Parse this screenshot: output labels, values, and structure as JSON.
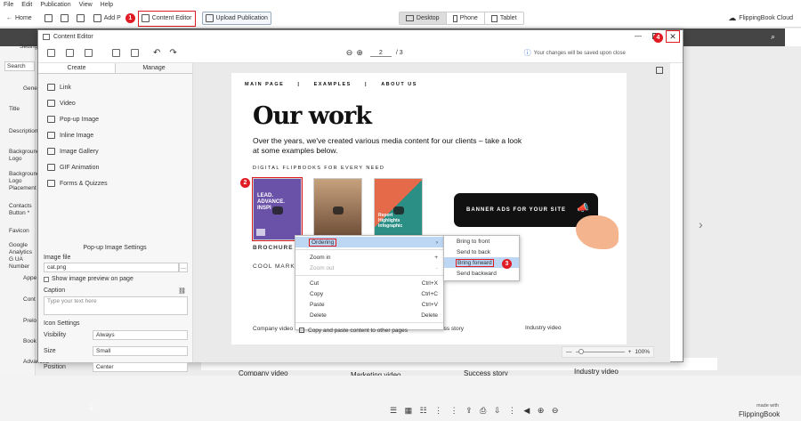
{
  "menubar": [
    "File",
    "Edit",
    "Publication",
    "View",
    "Help"
  ],
  "toolbar": {
    "home": "Home",
    "add": "Add P",
    "content_editor": "Content Editor",
    "upload": "Upload Publication",
    "devices": [
      "Desktop",
      "Phone",
      "Tablet"
    ],
    "cloud": "FlippingBook Cloud"
  },
  "badges": [
    "1",
    "2",
    "3",
    "4"
  ],
  "bg_left": {
    "settings": "Setting",
    "search": "Search",
    "items": [
      "Gene",
      "Title",
      "Description",
      "Background Logo",
      "Background Logo Placement",
      "Contacts Button *",
      "Favicon",
      "Google Analytics G UA Number",
      "Appe",
      "Cont",
      "Prelo",
      "Book",
      "Advanced"
    ]
  },
  "bg_captions": [
    "Company video",
    "Marketing video",
    "Success story",
    "Industry video"
  ],
  "bg_footer": {
    "page": "2",
    "made_with": "made with",
    "brand": "FlippingBook"
  },
  "dialog": {
    "title": "Content Editor",
    "page_current": "2",
    "page_total": "/ 3",
    "save_note": "Your changes will be saved upon close",
    "tabs": [
      "Create",
      "Manage"
    ],
    "widgets": [
      "Link",
      "Video",
      "Pop-up Image",
      "Inline Image",
      "Image Gallery",
      "GIF Animation",
      "Forms & Quizzes"
    ],
    "settings_title": "Pop-up Image Settings",
    "image_file_label": "Image file",
    "image_file_value": "cat.png",
    "show_preview": "Show image preview on page",
    "caption_label": "Caption",
    "caption_placeholder": "Type your text here",
    "icon_settings": "Icon Settings",
    "visibility_label": "Visibility",
    "visibility_value": "Always",
    "size_label": "Size",
    "size_value": "Small",
    "position_label": "Position",
    "position_value": "Center",
    "zoom": "100%"
  },
  "page": {
    "nav": [
      "MAIN PAGE",
      "|",
      "EXAMPLES",
      "|",
      "ABOUT US"
    ],
    "heading": "Our work",
    "subtitle": "Over the years, we've created various media content for our clients – take a look at some examples below.",
    "section": "DIGITAL FLIPBOOKS FOR EVERY NEED",
    "thumb1": "LEAD. ADVANCE. INSPI",
    "thumb3": "Report Highlights Infographic",
    "brochure": "BROCHURE",
    "cool": "COOL MARKI",
    "banner": "BANNER ADS FOR YOUR SITE",
    "captions": [
      "Company video",
      "ess story",
      "Industry video"
    ]
  },
  "context_menu": [
    {
      "label": "Ordering",
      "shortcut": ""
    },
    {
      "label": "Zoom in",
      "shortcut": "+"
    },
    {
      "label": "Zoom out",
      "shortcut": "-"
    },
    {
      "label": "Cut",
      "shortcut": "Ctrl+X"
    },
    {
      "label": "Copy",
      "shortcut": "Ctrl+C"
    },
    {
      "label": "Paste",
      "shortcut": "Ctrl+V"
    },
    {
      "label": "Delete",
      "shortcut": "Delete"
    },
    {
      "label": "Copy and paste content to other pages",
      "shortcut": ""
    }
  ],
  "submenu": [
    "Bring to front",
    "Send to back",
    "Bring forward",
    "Send backward"
  ],
  "colors": {
    "accent": "#e01b24",
    "highlight": "#bcd6f4",
    "dark": "#454545"
  }
}
